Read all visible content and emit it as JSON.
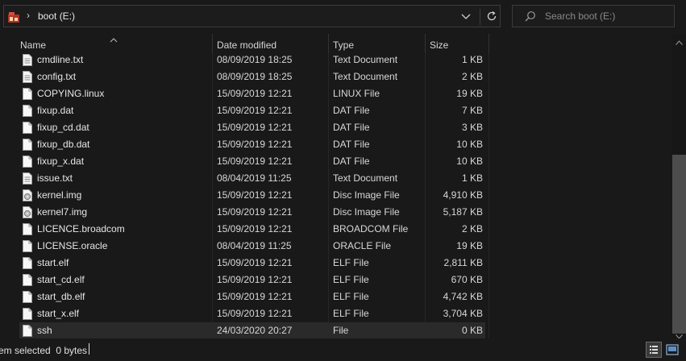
{
  "address_bar": {
    "path_label": "boot (E:)",
    "app_icon": "folder-app-icon",
    "chevron": "chevron-right-icon",
    "dropdown": "chevron-down-icon",
    "refresh": "refresh-icon"
  },
  "search": {
    "placeholder": "Search boot (E:)",
    "icon": "search-icon"
  },
  "columns": {
    "name": "Name",
    "date": "Date modified",
    "type": "Type",
    "size": "Size"
  },
  "files": [
    {
      "name": "cmdline.txt",
      "date": "08/09/2019 18:25",
      "type": "Text Document",
      "size": "1 KB",
      "icon": "text-file-icon"
    },
    {
      "name": "config.txt",
      "date": "08/09/2019 18:25",
      "type": "Text Document",
      "size": "2 KB",
      "icon": "text-file-icon"
    },
    {
      "name": "COPYING.linux",
      "date": "15/09/2019 12:21",
      "type": "LINUX File",
      "size": "19 KB",
      "icon": "file-icon"
    },
    {
      "name": "fixup.dat",
      "date": "15/09/2019 12:21",
      "type": "DAT File",
      "size": "7 KB",
      "icon": "file-icon"
    },
    {
      "name": "fixup_cd.dat",
      "date": "15/09/2019 12:21",
      "type": "DAT File",
      "size": "3 KB",
      "icon": "file-icon"
    },
    {
      "name": "fixup_db.dat",
      "date": "15/09/2019 12:21",
      "type": "DAT File",
      "size": "10 KB",
      "icon": "file-icon"
    },
    {
      "name": "fixup_x.dat",
      "date": "15/09/2019 12:21",
      "type": "DAT File",
      "size": "10 KB",
      "icon": "file-icon"
    },
    {
      "name": "issue.txt",
      "date": "08/04/2019 11:25",
      "type": "Text Document",
      "size": "1 KB",
      "icon": "text-file-icon"
    },
    {
      "name": "kernel.img",
      "date": "15/09/2019 12:21",
      "type": "Disc Image File",
      "size": "4,910 KB",
      "icon": "disc-image-icon"
    },
    {
      "name": "kernel7.img",
      "date": "15/09/2019 12:21",
      "type": "Disc Image File",
      "size": "5,187 KB",
      "icon": "disc-image-icon"
    },
    {
      "name": "LICENCE.broadcom",
      "date": "15/09/2019 12:21",
      "type": "BROADCOM File",
      "size": "2 KB",
      "icon": "file-icon"
    },
    {
      "name": "LICENSE.oracle",
      "date": "08/04/2019 11:25",
      "type": "ORACLE File",
      "size": "19 KB",
      "icon": "file-icon"
    },
    {
      "name": "start.elf",
      "date": "15/09/2019 12:21",
      "type": "ELF File",
      "size": "2,811 KB",
      "icon": "file-icon"
    },
    {
      "name": "start_cd.elf",
      "date": "15/09/2019 12:21",
      "type": "ELF File",
      "size": "670 KB",
      "icon": "file-icon"
    },
    {
      "name": "start_db.elf",
      "date": "15/09/2019 12:21",
      "type": "ELF File",
      "size": "4,742 KB",
      "icon": "file-icon"
    },
    {
      "name": "start_x.elf",
      "date": "15/09/2019 12:21",
      "type": "ELF File",
      "size": "3,704 KB",
      "icon": "file-icon"
    },
    {
      "name": "ssh",
      "date": "24/03/2020 20:27",
      "type": "File",
      "size": "0 KB",
      "icon": "file-icon",
      "selected": true
    }
  ],
  "status": {
    "text": "em selected  0 bytes"
  },
  "view_buttons": {
    "details": "details-view-icon",
    "large_icons": "large-icons-view-icon"
  },
  "colors": {
    "background": "#191919",
    "selected_row": "#2a2a2a",
    "text": "#e6e6e6",
    "scroll_thumb": "#4d4d4d"
  }
}
